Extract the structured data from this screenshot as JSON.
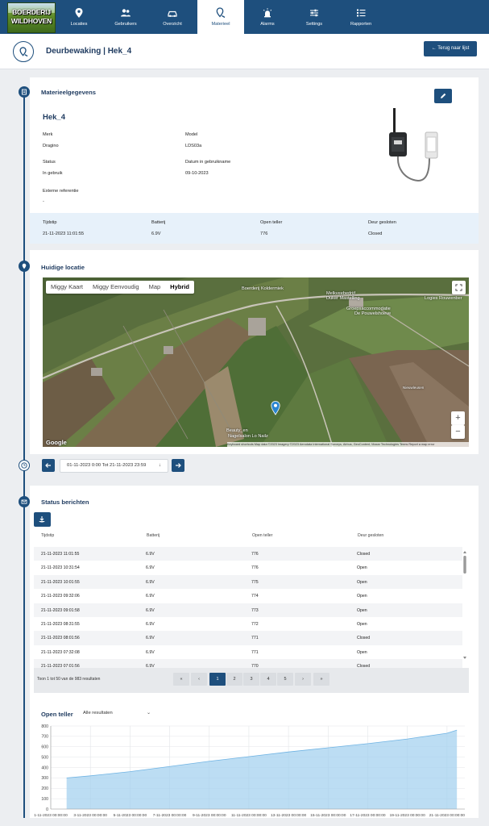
{
  "nav": {
    "logo_line1": "BOERDERIJ",
    "logo_line2": "WILDHOVEN",
    "items": [
      {
        "label": "Locaties",
        "icon": "map-pin-icon"
      },
      {
        "label": "Gebruikers",
        "icon": "users-icon"
      },
      {
        "label": "Overzicht",
        "icon": "car-icon"
      },
      {
        "label": "Materieel",
        "icon": "location-pin-icon",
        "active": true
      },
      {
        "label": "Alarms",
        "icon": "alarm-icon"
      },
      {
        "label": "Settings",
        "icon": "sliders-icon"
      },
      {
        "label": "Rapporten",
        "icon": "list-icon"
      }
    ]
  },
  "header": {
    "title": "Deurbewaking | Hek_4",
    "back_label": "Terug naar lijst"
  },
  "material": {
    "section_title": "Materieelgegevens",
    "name": "Hek_4",
    "merk_label": "Merk",
    "merk": "Dragino",
    "model_label": "Model",
    "model": "LDS03a",
    "status_label": "Status",
    "status": "In gebruik",
    "date_label": "Datum in gebruikname",
    "date": "09-10-2023",
    "ref_label": "Externe referentie",
    "ref": "-",
    "latest": {
      "tijdstip_label": "Tijdstip",
      "tijdstip": "21-11-2023 11:01:55",
      "batterij_label": "Batterij",
      "batterij": "6.9V",
      "teller_label": "Open teller",
      "teller": "776",
      "deur_label": "Deur gesloten",
      "deur": "Closed"
    }
  },
  "location": {
    "section_title": "Huidige locatie",
    "map_types": [
      "Miggy Kaart",
      "Miggy Eenvoudig",
      "Map",
      "Hybrid"
    ],
    "selected_type": "Hybrid",
    "labels": {
      "koldermiek": "Boerderij Koldermiek",
      "melkveebedrijf": "Melkveebedrijf",
      "duker": "Duker Mastelling",
      "groeps": "Groepsaccommodatie",
      "pouwelshoeve": "De Pouwelshoeve",
      "logies": "Logies Rouwenber",
      "beauty": "Beauty_en",
      "nagelsalon": "Nagelsalon Lo Nailz",
      "nieuwleusen": "Nieuwleusen"
    },
    "zoom_in": "+",
    "zoom_out": "−",
    "google": "Google",
    "attribution": "Keyboard shortcuts  Map data ©2023 Imagery ©2023 Aerodata International Surveys, Airbus, GeoContent, Maxar Technologies   Terms   Report a map error"
  },
  "range": {
    "text": "01-11-2023 0:00 Tot 21-11-2023 23:59"
  },
  "status": {
    "section_title": "Status berichten",
    "headers": [
      "Tijdstip",
      "Batterij",
      "Open teller",
      "Deur gesloten"
    ],
    "rows": [
      [
        "21-11-2023 11:01:55",
        "6.9V",
        "776",
        "Closed"
      ],
      [
        "21-11-2023 10:31:54",
        "6.9V",
        "776",
        "Open"
      ],
      [
        "21-11-2023 10:01:55",
        "6.9V",
        "775",
        "Open"
      ],
      [
        "21-11-2023 09:32:06",
        "6.9V",
        "774",
        "Open"
      ],
      [
        "21-11-2023 09:01:58",
        "6.9V",
        "773",
        "Open"
      ],
      [
        "21-11-2023 08:31:55",
        "6.9V",
        "772",
        "Open"
      ],
      [
        "21-11-2023 08:01:56",
        "6.9V",
        "771",
        "Closed"
      ],
      [
        "21-11-2023 07:32:08",
        "6.9V",
        "771",
        "Open"
      ],
      [
        "21-11-2023 07:01:56",
        "6.9V",
        "770",
        "Closed"
      ]
    ],
    "footer": "Toon 1 tot 50 van de 983 resultaten",
    "pages": [
      "«",
      "‹",
      "1",
      "2",
      "3",
      "4",
      "5",
      "›",
      "»"
    ],
    "current_page": "1"
  },
  "chart_data": {
    "type": "area",
    "title": "Open teller",
    "filter": "Alle resultaten",
    "ylim": [
      0,
      800
    ],
    "yticks": [
      "0",
      "100",
      "200",
      "300",
      "400",
      "500",
      "600",
      "700",
      "800"
    ],
    "xticks": [
      "1-11-2023 00:00:00",
      "3-11-2023 00:00:00",
      "5-11-2023 00:00:00",
      "7-11-2023 00:00:00",
      "9-11-2023 00:00:00",
      "11-11-2023 00:00:00",
      "13-11-2023 00:00:00",
      "15-11-2023 00:00:00",
      "17-11-2023 00:00:00",
      "19-11-2023 00:00:00",
      "21-11-2023 00:00:00"
    ],
    "x_days": [
      1.8,
      3,
      5,
      7,
      9,
      11,
      13,
      15,
      17,
      19,
      21,
      21.5
    ],
    "values": [
      300,
      320,
      360,
      410,
      460,
      505,
      550,
      590,
      630,
      675,
      730,
      760
    ],
    "grid": true,
    "color": "#9fcfee"
  }
}
